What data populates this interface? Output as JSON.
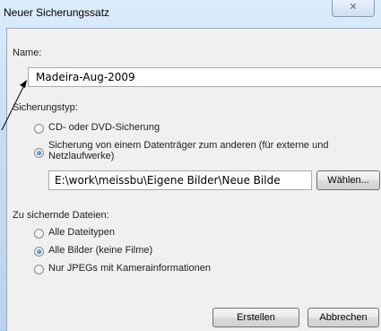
{
  "window": {
    "title": "Neuer Sicherungssatz",
    "close_glyph": "✕"
  },
  "name_section": {
    "label": "Name:",
    "value": "Madeira-Aug-2009"
  },
  "backup_type": {
    "label": "Sicherungstyp:",
    "options": [
      {
        "label": "CD- oder DVD-Sicherung",
        "selected": false
      },
      {
        "label": "Sicherung von einem Datenträger zum anderen (für externe und",
        "label_line2": "Netzlaufwerke)",
        "selected": true
      }
    ],
    "path_value": "E:\\work\\meissbu\\Eigene Bilder\\Neue Bilde",
    "choose_button": "Wählen..."
  },
  "files_section": {
    "label": "Zu sichernde Dateien:",
    "options": [
      {
        "label": "Alle Dateitypen",
        "selected": false
      },
      {
        "label": "Alle Bilder (keine Filme)",
        "selected": true
      },
      {
        "label": "Nur JPEGs mit Kamerainformationen",
        "selected": false
      }
    ]
  },
  "footer": {
    "create_button": "Erstellen",
    "cancel_button": "Abbrechen"
  }
}
